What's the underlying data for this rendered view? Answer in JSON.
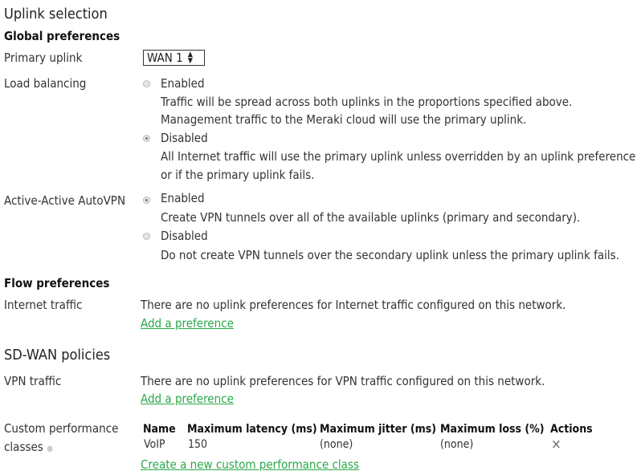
{
  "page": {
    "title": "Uplink selection"
  },
  "global_preferences": {
    "heading": "Global preferences",
    "primary_uplink": {
      "label": "Primary uplink",
      "value": "WAN 1",
      "icon": "updown-arrows-icon"
    },
    "load_balancing": {
      "label": "Load balancing",
      "options": [
        {
          "label": "Enabled",
          "checked": false,
          "description": [
            "Traffic will be spread across both uplinks in the proportions specified above.",
            "Management traffic to the Meraki cloud will use the primary uplink."
          ]
        },
        {
          "label": "Disabled",
          "checked": true,
          "description": [
            "All Internet traffic will use the primary uplink unless overridden by an uplink preference",
            "or if the  primary uplink fails."
          ]
        }
      ]
    },
    "active_active_autovpn": {
      "label": "Active-Active AutoVPN",
      "options": [
        {
          "label": "Enabled",
          "checked": true,
          "description": [
            "Create VPN tunnels over all of the available uplinks (primary and secondary)."
          ]
        },
        {
          "label": "Disabled",
          "checked": false,
          "description": [
            "Do not create VPN tunnels over the secondary uplink unless the primary uplink fails."
          ]
        }
      ]
    }
  },
  "flow_preferences": {
    "heading": "Flow preferences",
    "internet_traffic": {
      "label": "Internet traffic",
      "message": "There are no uplink preferences for Internet traffic configured on this network.",
      "link": "Add a preference"
    }
  },
  "sdwan_policies": {
    "heading": "SD-WAN policies",
    "vpn_traffic": {
      "label": "VPN traffic",
      "message": "There are no uplink preferences for  VPN traffic configured on this network.",
      "link": "Add a preference"
    },
    "custom_performance_classes": {
      "label_line1": "Custom performance",
      "label_line2": "classes",
      "help_icon": "help-icon",
      "columns": [
        "Name",
        "Maximum latency (ms)",
        "Maximum jitter (ms)",
        "Maximum loss (%)",
        "Actions"
      ],
      "rows": [
        {
          "name": "VoIP",
          "latency": "150",
          "jitter": "(none)",
          "loss": "(none)",
          "action": "×"
        }
      ],
      "create_link": "Create a new custom performance class"
    }
  },
  "colors": {
    "link": "#2aa84a",
    "text": "#333333"
  }
}
